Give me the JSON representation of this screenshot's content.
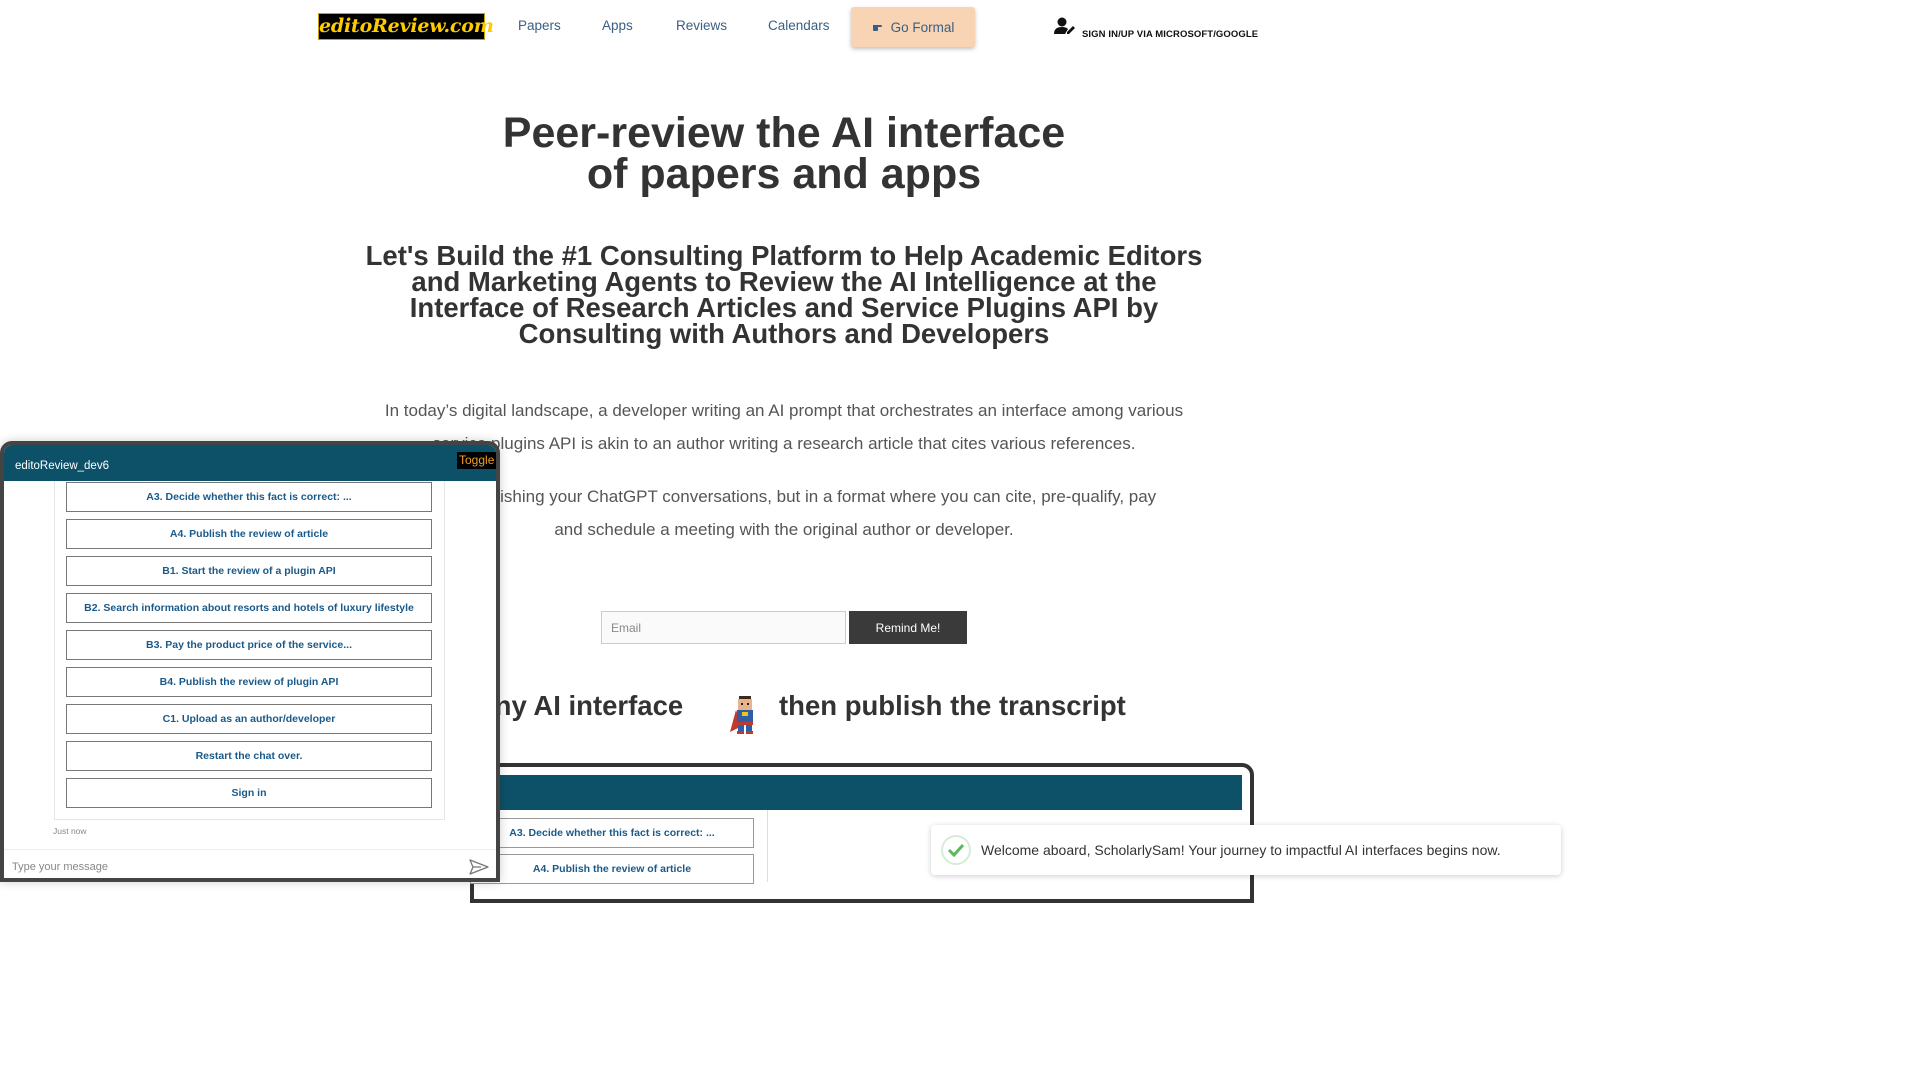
{
  "nav": {
    "logo": "editoReview.com",
    "links": [
      "Papers",
      "Apps",
      "Reviews",
      "Calendars"
    ],
    "go_formal": "Go Formal",
    "signin": "SIGN IN/UP VIA MICROSOFT/GOOGLE"
  },
  "hero": {
    "title_line1": "Peer-review the AI interface",
    "title_line2": "of papers and apps",
    "subtitle_line1": "Let's Build the #1 Consulting Platform to Help Academic Editors",
    "subtitle_line2": "and Marketing Agents to Review the AI Intelligence at the",
    "subtitle_line3": "Interface of Research Articles and Service Plugins API by",
    "subtitle_line4": "Consulting with Authors and Developers",
    "para1_line1": "In today’s digital landscape, a developer writing an AI prompt that orchestrates an interface among various",
    "para1_line2": "service plugins API is akin to an author writing a research article that cites various references.",
    "para2_line1": "It's like publishing your ChatGPT conversations, but in a format where you can cite, pre-qualify, pay",
    "para2_line2": "and schedule a meeting with the original author or developer."
  },
  "form": {
    "email_placeholder": "Email",
    "remind_label": "Remind Me!"
  },
  "section": {
    "left_text": "Chat with any AI interface",
    "right_text": "then publish the transcript"
  },
  "demo": {
    "options": [
      "A3. Decide whether this fact is correct: ...",
      "A4. Publish the review of article"
    ]
  },
  "toast": {
    "message": "Welcome aboard, ScholarlySam! Your journey to impactful AI interfaces begins now."
  },
  "chat": {
    "title": "editoReview_dev6",
    "toggle_label": "Toggle",
    "options": [
      "A3. Decide whether this fact is correct: ...",
      "A4. Publish the review of article",
      "B1. Start the review of a plugin API",
      "B2. Search information about resorts and hotels of luxury lifestyle",
      "B3. Pay the product price of the service...",
      "B4. Publish the review of plugin API",
      "C1. Upload as an author/developer",
      "Restart the chat over.",
      "Sign in"
    ],
    "timestamp": "Just now",
    "input_placeholder": "Type your message"
  },
  "colors": {
    "header_teal": "#0d5168",
    "link_blue": "#3a5f82",
    "option_blue": "#1a5a8a",
    "go_formal_bg": "#f8d4b4",
    "toast_check": "#5cb85c"
  },
  "icons": {
    "signin": "user-edit-icon",
    "go_formal": "pointing-hand-icon",
    "toast": "check-circle-icon",
    "send": "send-icon"
  }
}
